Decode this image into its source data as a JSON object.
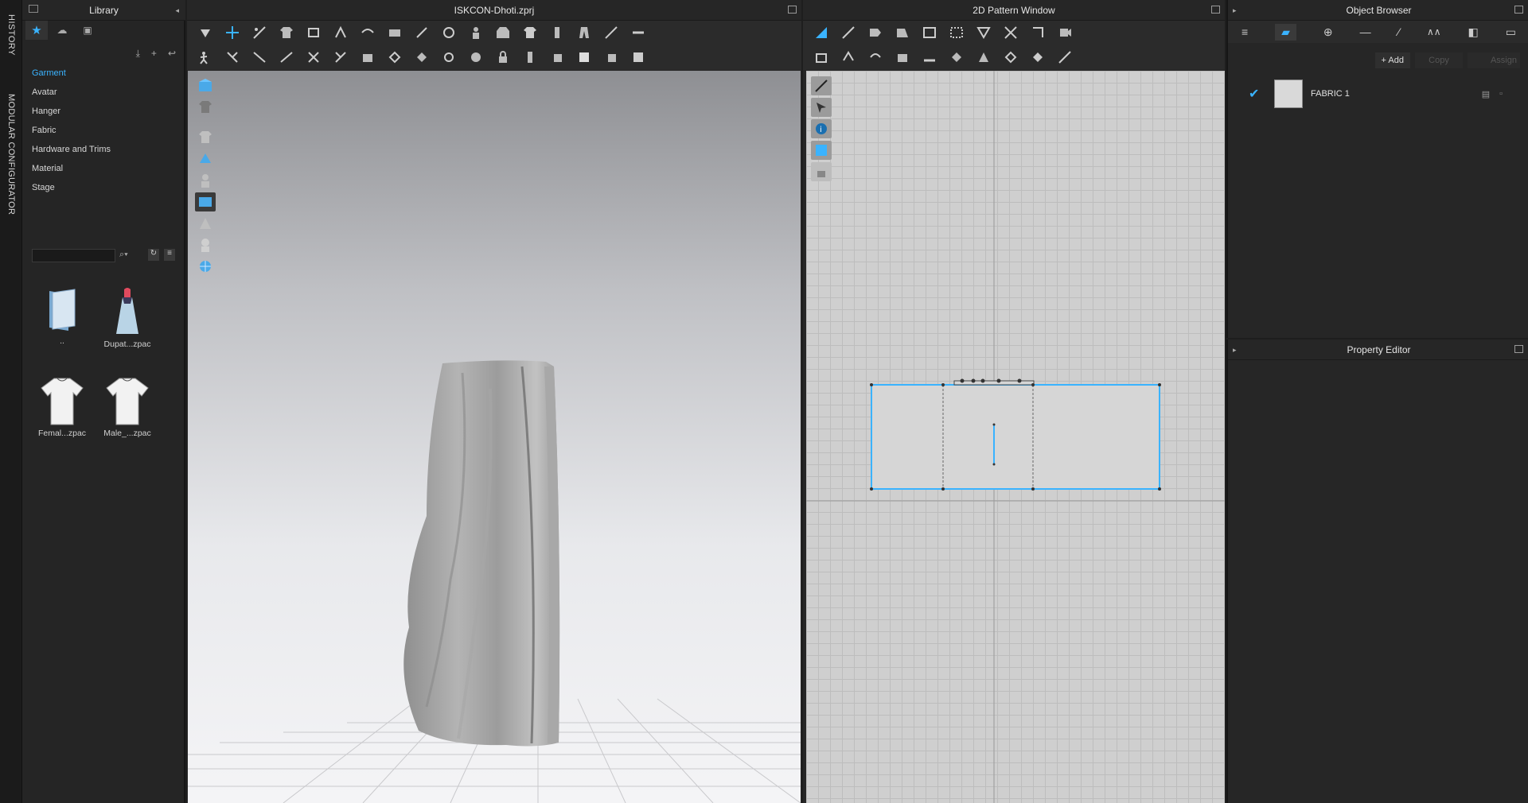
{
  "history_tab": "HISTORY",
  "modular_tab": "MODULAR CONFIGURATOR",
  "library": {
    "title": "Library",
    "categories": [
      "Garment",
      "Avatar",
      "Hanger",
      "Fabric",
      "Hardware and Trims",
      "Material",
      "Stage"
    ],
    "search_placeholder": "",
    "items": [
      {
        "label": "..",
        "icon": "folder-icon"
      },
      {
        "label": "Dupat...zpac",
        "icon": "dress-icon"
      },
      {
        "label": "Femal...zpac",
        "icon": "tshirt-icon"
      },
      {
        "label": "Male_...zpac",
        "icon": "tshirt-icon"
      }
    ]
  },
  "viewport3d": {
    "title": "ISKCON-Dhoti.zprj"
  },
  "pattern2d": {
    "title": "2D Pattern Window"
  },
  "object_browser": {
    "title": "Object Browser",
    "add_label": "Add",
    "copy_label": "Copy",
    "assign_label": "Assign",
    "fabrics": [
      {
        "name": "FABRIC 1",
        "checked": true
      }
    ]
  },
  "property_editor": {
    "title": "Property Editor"
  },
  "colors": {
    "accent": "#3ab3ff",
    "panel_bg": "#262626",
    "grid_bg": "#cfcfcf"
  }
}
